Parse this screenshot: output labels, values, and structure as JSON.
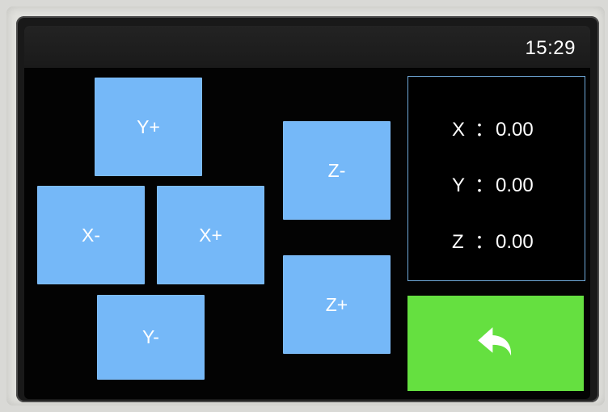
{
  "status_bar": {
    "time": "15:29"
  },
  "controls": {
    "y_plus": "Y+",
    "x_minus": "X-",
    "x_plus": "X+",
    "y_minus": "Y-",
    "z_minus": "Z-",
    "z_plus": "Z+",
    "back_icon": "back-arrow-icon"
  },
  "position": {
    "x_label": "X",
    "x_value": "0.00",
    "y_label": "Y",
    "y_value": "0.00",
    "z_label": "Z",
    "z_value": "0.00",
    "separator": "："
  },
  "colors": {
    "button_blue": "#75b8f8",
    "back_green": "#65e040",
    "screen_black": "#030303",
    "text_white": "#ffffff"
  }
}
